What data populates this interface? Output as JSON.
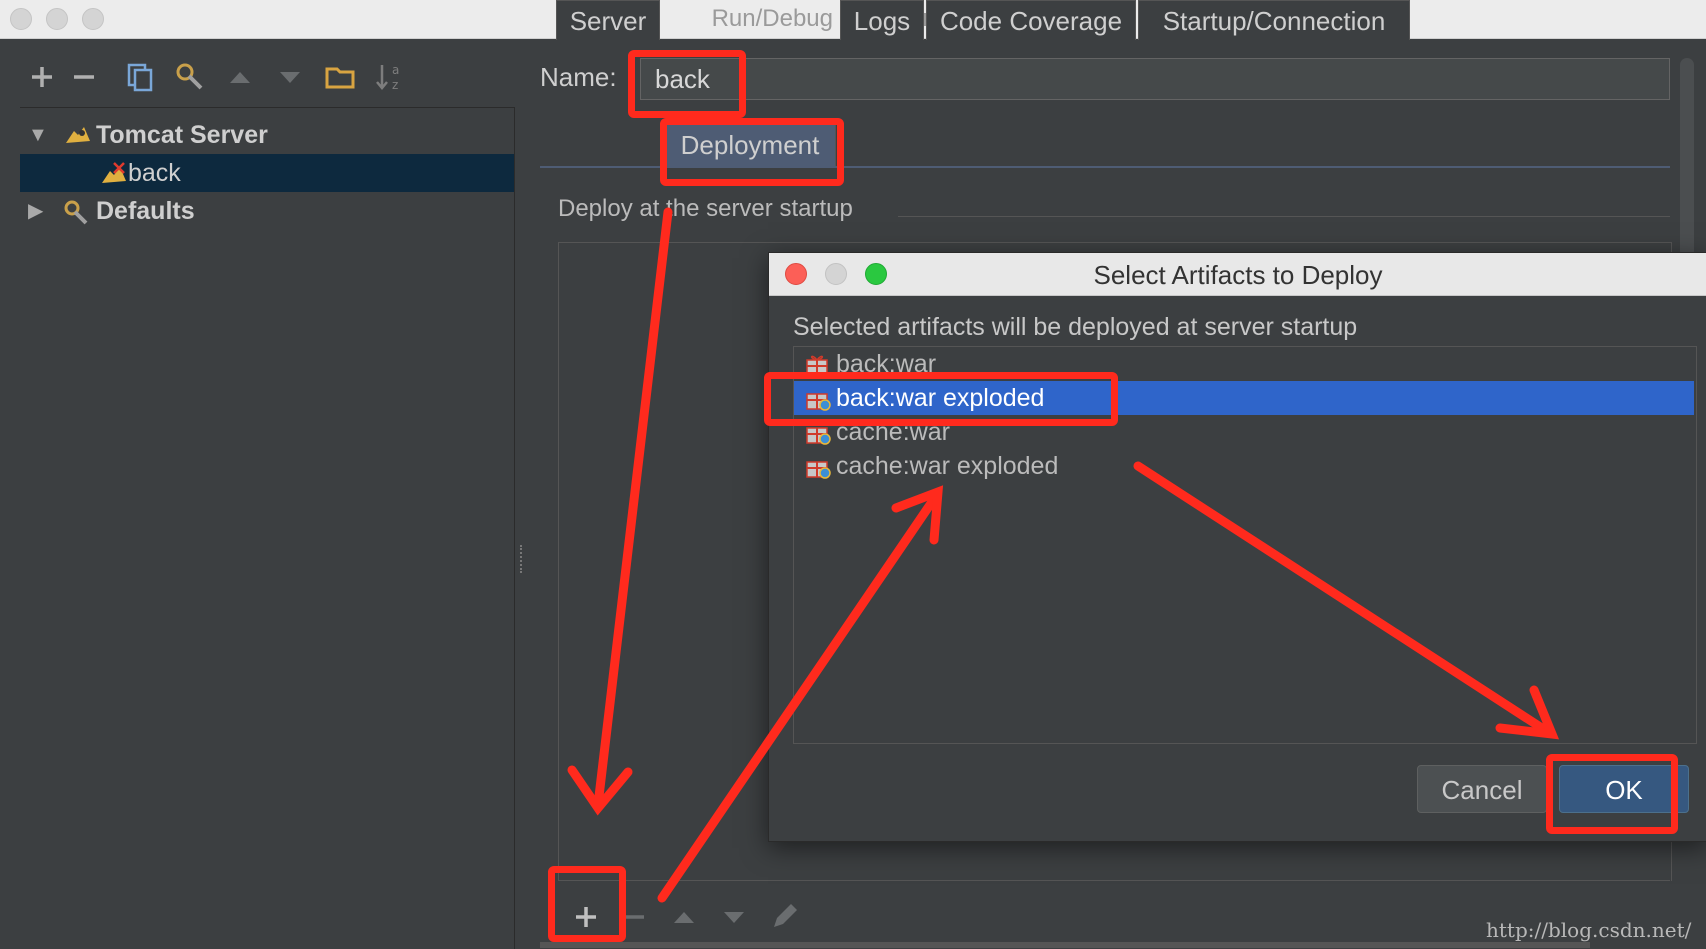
{
  "window": {
    "title": "Run/Debug Configurations"
  },
  "toolbar": {
    "icons": [
      "add-icon",
      "remove-icon",
      "copy-icon",
      "wrench-icon",
      "move-up-icon",
      "move-down-icon",
      "folder-icon",
      "sort-alpha-icon"
    ]
  },
  "tree": {
    "items": [
      {
        "label": "Tomcat Server",
        "expanded": true,
        "icon": "tomcat-icon"
      },
      {
        "label": "back",
        "selected": true,
        "icon": "tomcat-config-icon"
      },
      {
        "label": "Defaults",
        "expanded": false,
        "icon": "defaults-icon"
      }
    ]
  },
  "config": {
    "name_label": "Name:",
    "name_value": "back"
  },
  "tabs": [
    {
      "label": "Server",
      "active": false
    },
    {
      "label": "Deployment",
      "active": true
    },
    {
      "label": "Logs",
      "active": false
    },
    {
      "label": "Code Coverage",
      "active": false
    },
    {
      "label": "Startup/Connection",
      "active": false
    }
  ],
  "deployment": {
    "section_label": "Deploy at the server startup",
    "toolbar_icons": [
      "add-icon",
      "remove-icon",
      "move-up-icon",
      "move-down-icon",
      "edit-icon"
    ]
  },
  "dialog": {
    "title": "Select Artifacts to Deploy",
    "description": "Selected artifacts will be deployed at server startup",
    "artifacts": [
      {
        "label": "back:war",
        "selected": false
      },
      {
        "label": "back:war exploded",
        "selected": true
      },
      {
        "label": "cache:war",
        "selected": false
      },
      {
        "label": "cache:war exploded",
        "selected": false
      }
    ],
    "cancel_label": "Cancel",
    "ok_label": "OK"
  },
  "annotations": {
    "color": "#ff2a1d"
  },
  "colors": {
    "selection_blue": "#2f65ca",
    "tree_selection": "#0d293e",
    "active_tab": "#4e5c74"
  },
  "watermark": "http://blog.csdn.net/"
}
